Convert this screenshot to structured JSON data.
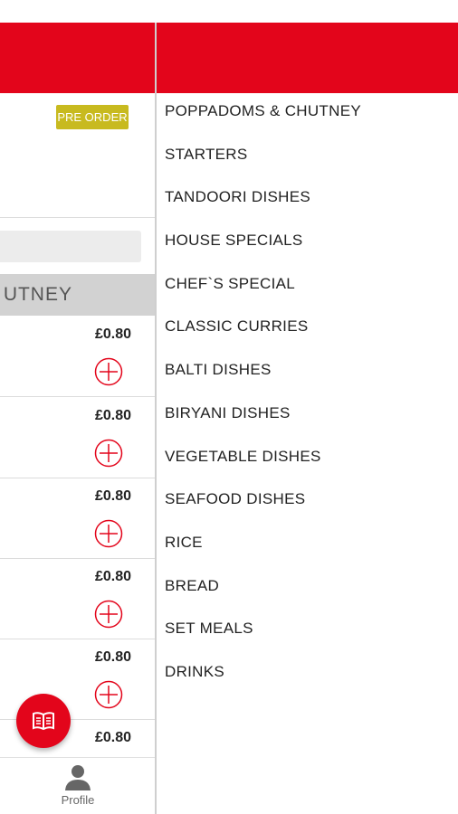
{
  "header": {
    "accent_color": "#e3051b"
  },
  "left_panel": {
    "badge": "PRE ORDER",
    "category_title": "UTNEY",
    "items": [
      {
        "price": "£0.80"
      },
      {
        "price": "£0.80"
      },
      {
        "price": "£0.80"
      },
      {
        "price": "£0.80"
      },
      {
        "price": "£0.80"
      },
      {
        "price": "£0.80"
      }
    ]
  },
  "fab": {
    "icon": "menu-book-icon"
  },
  "bottom_nav": {
    "profile_label": "Profile",
    "icon": "person-icon"
  },
  "menu_categories": [
    "POPPADOMS & CHUTNEY",
    "STARTERS",
    "TANDOORI DISHES",
    "HOUSE SPECIALS",
    "CHEF`S SPECIAL",
    "CLASSIC CURRIES",
    "BALTI DISHES",
    "BIRYANI DISHES",
    "VEGETABLE DISHES",
    "SEAFOOD DISHES",
    "RICE",
    "BREAD",
    "SET MEALS",
    "DRINKS"
  ]
}
